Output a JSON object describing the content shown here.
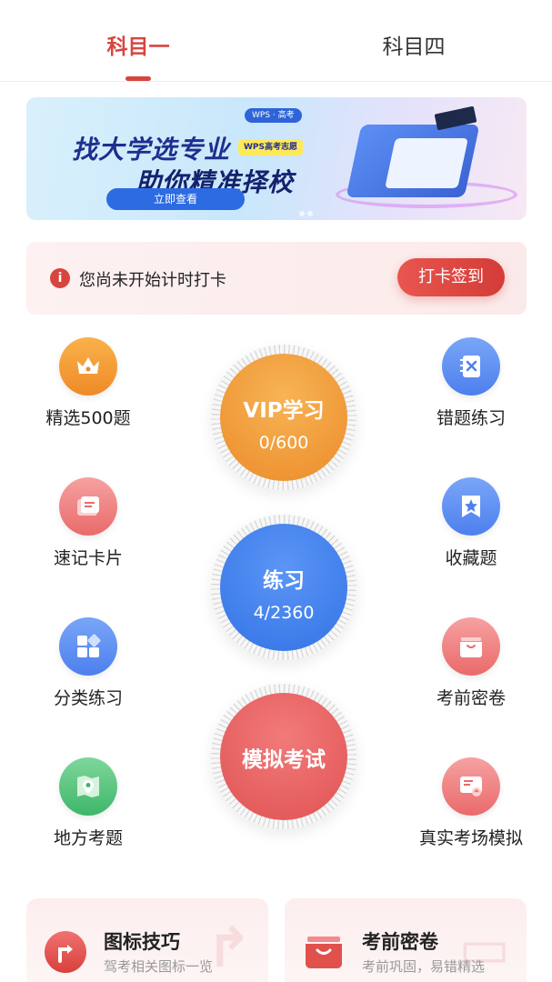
{
  "tabs": [
    {
      "label": "科目一",
      "active": true
    },
    {
      "label": "科目四",
      "active": false
    }
  ],
  "banner": {
    "top_chip": "WPS · 高考",
    "headline_1": "找大学选专业",
    "headline_2": "助你精准择校",
    "tag": "WPS高考志愿",
    "cta": "立即查看"
  },
  "checkin": {
    "icon": "info-icon",
    "message": "您尚未开始计时打卡",
    "button": "打卡签到"
  },
  "features_left": [
    {
      "label": "精选500题",
      "icon": "crown-icon",
      "color": "#ef8a28"
    },
    {
      "label": "速记卡片",
      "icon": "cards-icon",
      "color": "#ea6a6a"
    },
    {
      "label": "分类练习",
      "icon": "grid-icon",
      "color": "#4d7fee"
    },
    {
      "label": "地方考题",
      "icon": "map-pin-icon",
      "color": "#3fb66a"
    }
  ],
  "features_right": [
    {
      "label": "错题练习",
      "icon": "wrong-book-icon",
      "color": "#4d7fee"
    },
    {
      "label": "收藏题",
      "icon": "star-bookmark-icon",
      "color": "#4d7fee"
    },
    {
      "label": "考前密卷",
      "icon": "box-icon",
      "color": "#ea6a6a"
    },
    {
      "label": "真实考场模拟",
      "icon": "screen-icon",
      "color": "#ea6a6a"
    }
  ],
  "center": {
    "vip": {
      "title": "VIP学习",
      "progress": "0/600"
    },
    "practice": {
      "title": "练习",
      "progress": "4/2360"
    },
    "exam": {
      "title": "模拟考试"
    }
  },
  "cards": [
    {
      "title": "图标技巧",
      "subtitle": "驾考相关图标一览",
      "icon": "turn-arrow-icon"
    },
    {
      "title": "考前密卷",
      "subtitle": "考前巩固，易错精选",
      "icon": "box-icon"
    }
  ]
}
